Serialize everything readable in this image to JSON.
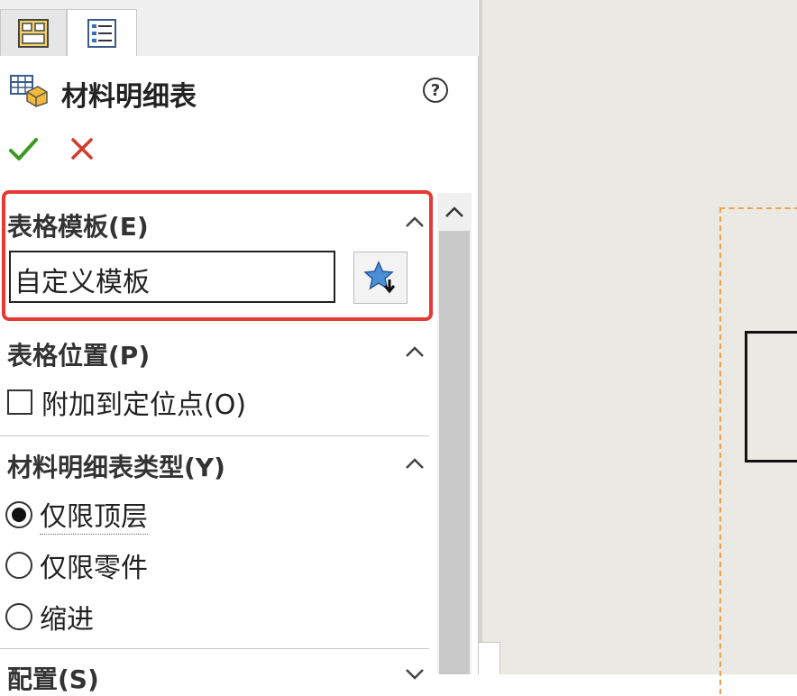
{
  "panel": {
    "title": "材料明细表",
    "help_label": "?"
  },
  "sections": {
    "table_template": {
      "title": "表格模板(E)",
      "input_value": "自定义模板"
    },
    "table_position": {
      "title": "表格位置(P)",
      "checkbox_label": "附加到定位点(O)",
      "checked": false
    },
    "bom_type": {
      "title": "材料明细表类型(Y)",
      "options": [
        "仅限顶层",
        "仅限零件",
        "缩进"
      ],
      "selected": "仅限顶层"
    },
    "configuration": {
      "title": "配置(S)"
    }
  },
  "icons": {
    "tab_feature": "feature-manager-icon",
    "tab_property": "property-manager-icon",
    "panel": "bom-table-icon",
    "ok": "check-icon",
    "cancel": "close-icon",
    "template_button": "favorite-star-download-icon"
  },
  "colors": {
    "highlight": "#e53935",
    "ok": "#3a9a1f",
    "cancel": "#d23a2a"
  }
}
